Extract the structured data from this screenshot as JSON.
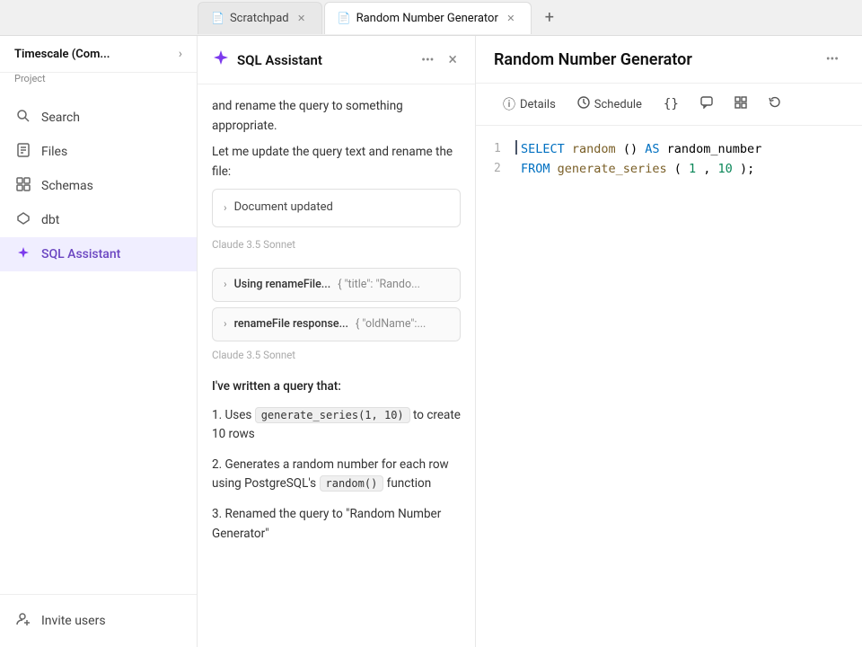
{
  "tabs": [
    {
      "id": "scratchpad",
      "label": "Scratchpad",
      "icon": "📄",
      "active": false
    },
    {
      "id": "random-number-generator",
      "label": "Random Number Generator",
      "icon": "📄",
      "active": true
    }
  ],
  "tab_add_label": "+",
  "sidebar": {
    "project_name": "Timescale (Com...",
    "project_sub": "Project",
    "items": [
      {
        "id": "search",
        "label": "Search",
        "icon": "🔍",
        "active": false
      },
      {
        "id": "files",
        "label": "Files",
        "icon": "📁",
        "active": false
      },
      {
        "id": "schemas",
        "label": "Schemas",
        "icon": "🔲",
        "active": false
      },
      {
        "id": "dbt",
        "label": "dbt",
        "icon": "◈",
        "active": false
      },
      {
        "id": "sql-assistant",
        "label": "SQL Assistant",
        "icon": "✦",
        "active": true
      }
    ],
    "bottom_items": [
      {
        "id": "invite-users",
        "label": "Invite users",
        "icon": "👤",
        "active": false
      }
    ]
  },
  "assistant": {
    "title": "SQL Assistant",
    "more_label": "•••",
    "close_label": "×",
    "messages": [
      {
        "text": "and rename the query to something appropriate.",
        "type": "text"
      },
      {
        "text": "Let me update the query text and rename the file:",
        "type": "text"
      },
      {
        "type": "doc-updated",
        "label": "Document updated"
      },
      {
        "type": "model-label",
        "label": "Claude 3.5 Sonnet"
      },
      {
        "type": "tool-call",
        "name": "Using renameFile...",
        "arg": "{ \"title\": \"Rando..."
      },
      {
        "type": "tool-call",
        "name": "renameFile response...",
        "arg": "{ \"oldName\":..."
      },
      {
        "type": "model-label",
        "label": "Claude 3.5 Sonnet"
      },
      {
        "type": "written-block",
        "title": "I've written a query that:",
        "items": [
          {
            "prefix": "1. Uses ",
            "code": "generate_series(1, 10)",
            "suffix": " to create 10 rows"
          },
          {
            "prefix": "2. Generates a random number for each row using PostgreSQL's ",
            "code": "random()",
            "suffix": " function"
          },
          {
            "prefix": "3. Renamed the query to \"Random Number Generator\"",
            "code": "",
            "suffix": ""
          }
        ]
      }
    ]
  },
  "editor": {
    "title": "Random Number Generator",
    "more_label": "•••",
    "toolbar": [
      {
        "id": "details",
        "label": "Details",
        "icon": "ⓘ"
      },
      {
        "id": "schedule",
        "label": "Schedule",
        "icon": "🕐"
      },
      {
        "id": "braces",
        "label": "{}",
        "icon": "{}"
      },
      {
        "id": "comment",
        "label": "Comment",
        "icon": "💬"
      },
      {
        "id": "grid",
        "label": "Grid",
        "icon": "⊞"
      },
      {
        "id": "history",
        "label": "History",
        "icon": "↺"
      }
    ],
    "code_lines": [
      {
        "number": "1",
        "tokens": [
          {
            "type": "kw",
            "text": "SELECT"
          },
          {
            "type": "text",
            "text": " "
          },
          {
            "type": "fn",
            "text": "random"
          },
          {
            "type": "text",
            "text": "()"
          },
          {
            "type": "text",
            "text": " "
          },
          {
            "type": "kw",
            "text": "AS"
          },
          {
            "type": "text",
            "text": " random_number"
          }
        ],
        "cursor": true
      },
      {
        "number": "2",
        "tokens": [
          {
            "type": "kw",
            "text": "FROM"
          },
          {
            "type": "text",
            "text": " "
          },
          {
            "type": "fn",
            "text": "generate_series"
          },
          {
            "type": "text",
            "text": "("
          },
          {
            "type": "num",
            "text": "1"
          },
          {
            "type": "text",
            "text": ", "
          },
          {
            "type": "num",
            "text": "10"
          },
          {
            "type": "text",
            "text": ");"
          }
        ],
        "cursor": false
      }
    ]
  }
}
